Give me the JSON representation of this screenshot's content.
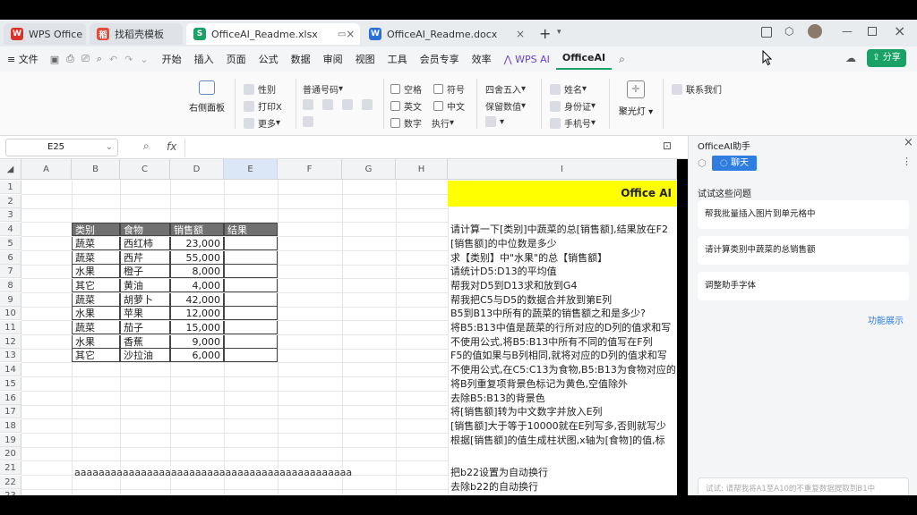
{
  "tabs": [
    {
      "label": "WPS Office",
      "icon": "W",
      "color": "#d9342b"
    },
    {
      "label": "找稻壳模板",
      "icon": "稻",
      "color": "#e44b3a"
    },
    {
      "label": "OfficeAI_Readme.xlsx",
      "icon": "S",
      "color": "#1aa266",
      "close": "×"
    },
    {
      "label": "OfficeAI_Readme.docx",
      "icon": "W",
      "color": "#2b6fd6",
      "close": "×"
    }
  ],
  "new_tab": "+",
  "menu": {
    "file": "≡ 文件",
    "items": [
      "开始",
      "插入",
      "页面",
      "公式",
      "数据",
      "审阅",
      "视图",
      "工具",
      "会员专享",
      "效率"
    ],
    "wps_ai": "WPS AI",
    "officeai": "OfficeAI",
    "share": "分享"
  },
  "ribbon": {
    "side_panel": "右侧面板",
    "g1": [
      "性别",
      "打印X",
      "更多"
    ],
    "number_format": "普通号码",
    "checks_a": [
      "空格",
      "英文",
      "数字"
    ],
    "checks_b": [
      "符号",
      "中文"
    ],
    "execute": "执行",
    "round": "四舍五入",
    "keep_value": "保留数值",
    "info": [
      "姓名",
      "身份证",
      "手机号"
    ],
    "spotlight": "聚光灯",
    "contact": "联系我们"
  },
  "formula_bar": {
    "cell_ref": "E25",
    "fx": "fx"
  },
  "columns": [
    "A",
    "B",
    "C",
    "D",
    "E",
    "F",
    "G",
    "H",
    "I"
  ],
  "rows": [
    "1",
    "2",
    "3",
    "4",
    "5",
    "6",
    "7",
    "8",
    "9",
    "10",
    "11",
    "12",
    "13",
    "14",
    "15",
    "16",
    "17",
    "18",
    "19",
    "20",
    "21",
    "22",
    "23"
  ],
  "table": {
    "headers": [
      "类别",
      "食物",
      "销售额",
      "结果"
    ],
    "rows": [
      [
        "蔬菜",
        "西红柿",
        "23,000"
      ],
      [
        "蔬菜",
        "西芹",
        "55,000"
      ],
      [
        "水果",
        "橙子",
        "8,000"
      ],
      [
        "其它",
        "黄油",
        "4,000"
      ],
      [
        "蔬菜",
        "胡萝卜",
        "42,000"
      ],
      [
        "水果",
        "苹果",
        "12,000"
      ],
      [
        "蔬菜",
        "茄子",
        "15,000"
      ],
      [
        "水果",
        "香蕉",
        "9,000"
      ],
      [
        "其它",
        "沙拉油",
        "6,000"
      ]
    ]
  },
  "i_title": "Office AI",
  "prompts": [
    "请计算一下[类别]中蔬菜的总[销售额],结果放在F2",
    "[销售额]的中位数是多少",
    "求【类别】中\"水果\"的总【销售额】",
    "请统计D5:D13的平均值",
    "帮我对D5到D13求和放到G4",
    "帮我把C5与D5的数据合并放到第E列",
    "B5到B13中所有的蔬菜的销售额之和是多少?",
    "将B5:B13中值是蔬菜的行所对应的D列的值求和写",
    "不使用公式,将B5:B13中所有不同的值写在F列",
    "F5的值如果与B列相同,就将对应的D列的值求和写",
    "不使用公式,在C5:C13为食物,B5:B13为食物对应的",
    "将B列重复项背景色标记为黄色,空值除外",
    "去除B5:B13的背景色",
    "将[销售额]转为中文数字并放入E列",
    "[销售额]大于等于10000就在E列写多,否则就写少",
    "根据[销售额]的值生成柱状图,x轴为[食物]的值,标"
  ],
  "b22": "aaaaaaaaaaaaaaaaaaaaaaaaaaaaaaaaaaaaaaaaaaaaaa",
  "prompts2": [
    "把b22设置为自动换行",
    "去除b22的自动换行"
  ],
  "panel": {
    "title": "OfficeAI助手",
    "chat": "聊天",
    "try_label": "试试这些问题",
    "suggestions": [
      "帮我批量插入图片到单元格中",
      "请计算类别中蔬菜的总销售额",
      "调整助手字体"
    ],
    "features": "功能展示",
    "input_placeholder": "试试: 请帮我将A1至A10的不重复数据提取到B1中"
  }
}
